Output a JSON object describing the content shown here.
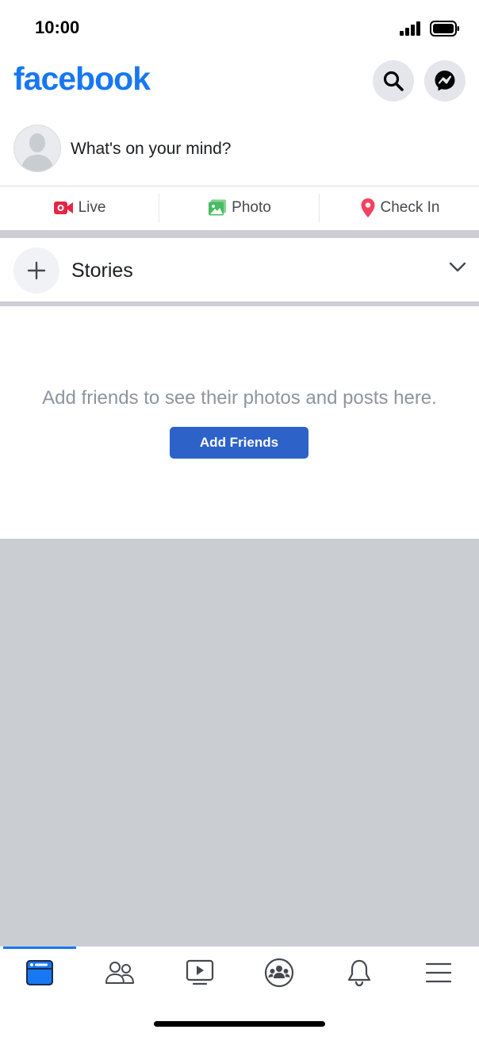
{
  "status_bar": {
    "time": "10:00"
  },
  "header": {
    "logo": "facebook",
    "search_icon": "search-icon",
    "messenger_icon": "messenger-icon"
  },
  "composer": {
    "prompt": "What's on your mind?"
  },
  "actions": {
    "live": "Live",
    "photo": "Photo",
    "check_in": "Check In"
  },
  "colors": {
    "brand": "#1877f2",
    "live_red": "#e42645",
    "photo_green": "#45bd62",
    "checkin_pink": "#f3425f",
    "button_blue": "#2d62c9",
    "divider_gray": "#cdced3"
  },
  "stories": {
    "label": "Stories"
  },
  "feed": {
    "empty_message": "Add friends to see their photos and posts here.",
    "add_friends_button": "Add Friends"
  },
  "tabs": [
    {
      "name": "home",
      "icon": "home-feed-icon",
      "active": true
    },
    {
      "name": "friends",
      "icon": "friends-icon",
      "active": false
    },
    {
      "name": "watch",
      "icon": "watch-icon",
      "active": false
    },
    {
      "name": "groups",
      "icon": "groups-icon",
      "active": false
    },
    {
      "name": "notifications",
      "icon": "bell-icon",
      "active": false
    },
    {
      "name": "menu",
      "icon": "menu-icon",
      "active": false
    }
  ]
}
